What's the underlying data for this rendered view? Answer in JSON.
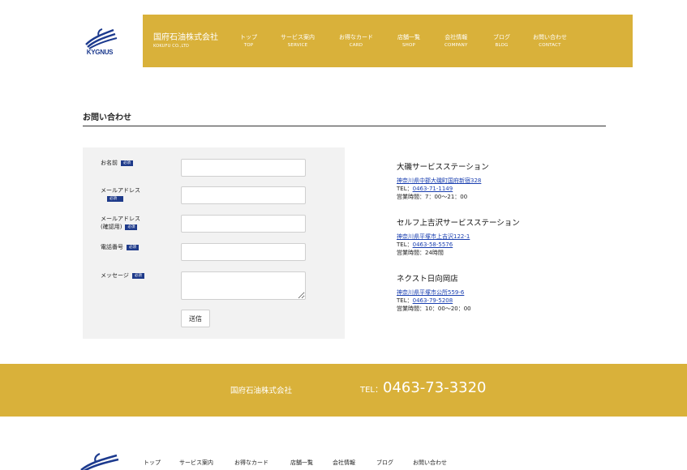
{
  "header": {
    "logo_text": "KYGNUS",
    "company_jp": "国府石油株式会社",
    "company_en": "KOKUFU CO.,LTD",
    "nav": [
      {
        "jp": "トップ",
        "en": "TOP"
      },
      {
        "jp": "サービス案内",
        "en": "SERVICE"
      },
      {
        "jp": "お得なカード",
        "en": "CARD"
      },
      {
        "jp": "店舗一覧",
        "en": "SHOP"
      },
      {
        "jp": "会社情報",
        "en": "COMPANY"
      },
      {
        "jp": "ブログ",
        "en": "BLOG"
      },
      {
        "jp": "お問い合わせ",
        "en": "CONTACT"
      }
    ]
  },
  "page": {
    "title": "お問い合わせ"
  },
  "form": {
    "required_badge": "必須",
    "fields": {
      "name": {
        "label": "お名前",
        "value": ""
      },
      "email": {
        "label": "メールアドレス",
        "value": ""
      },
      "email_confirm": {
        "label1": "メールアドレス",
        "label2": "(確認用)",
        "value": ""
      },
      "phone": {
        "label": "電話番号",
        "value": ""
      },
      "message": {
        "label": "メッセージ",
        "value": ""
      }
    },
    "submit_label": "送信"
  },
  "shops": [
    {
      "name": "大磯サービスステーション",
      "address": "神奈川県中郡大磯町国府新宿328",
      "tel_prefix": "TEL：",
      "tel": "0463-71-1149",
      "hours": "営業時間：7：00〜21：00"
    },
    {
      "name": "セルフ上吉沢サービスステーション",
      "address": "神奈川県平塚市上吉沢122-1",
      "tel_prefix": "TEL：",
      "tel": "0463-58-5576",
      "hours": "営業時間：24時間"
    },
    {
      "name": "ネクスト日向岡店",
      "address": "神奈川県平塚市公所559-6",
      "tel_prefix": "TEL：",
      "tel": "0463-79-5208",
      "hours": "営業時間：10：00〜20：00"
    }
  ],
  "footer": {
    "company": "国府石油株式会社",
    "tel_prefix": "TEL：",
    "tel": "0463-73-3320",
    "nav": [
      "トップ",
      "サービス案内",
      "お得なカード",
      "店舗一覧",
      "会社情報",
      "ブログ",
      "お問い合わせ"
    ]
  },
  "colors": {
    "brand_gold": "#d9b13a",
    "logo_blue": "#1c3a8e",
    "required_badge": "#1e3a8a",
    "link_blue": "#1a3fb0",
    "panel_gray": "#f2f2f2"
  },
  "icons": {
    "logo": "kygnus-swan-logo",
    "corner": "corner-decoration-icon"
  }
}
